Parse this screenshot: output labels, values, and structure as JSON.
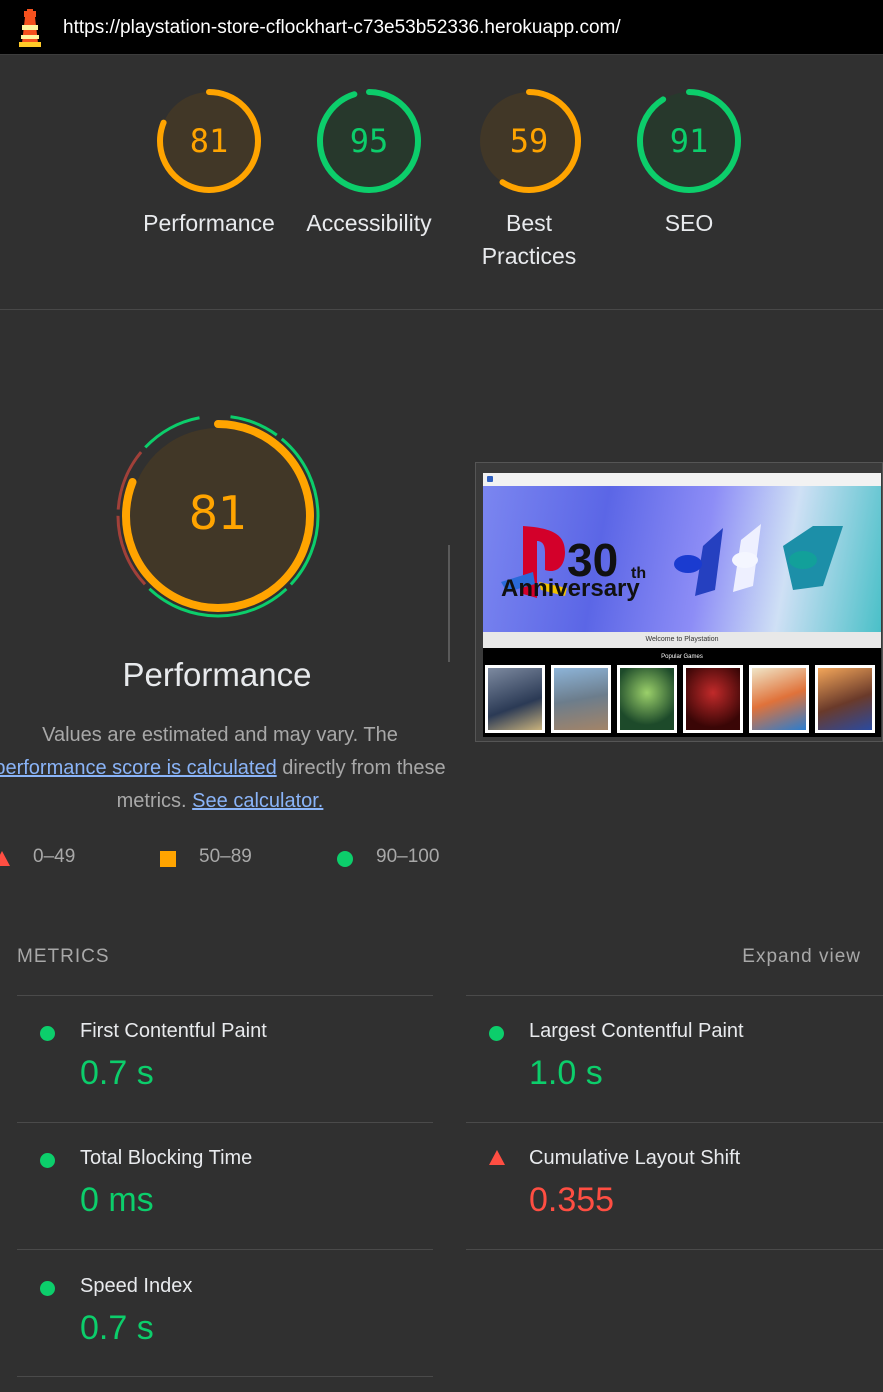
{
  "header": {
    "url": "https://playstation-store-cflockhart-c73e53b52336.herokuapp.com/"
  },
  "categories": [
    {
      "score": "81",
      "label": "Performance",
      "fraction": 0.81,
      "color": "#ffa400"
    },
    {
      "score": "95",
      "label": "Accessibility",
      "fraction": 0.95,
      "color": "#0cce6b"
    },
    {
      "score": "59",
      "label": "Best Practices",
      "fraction": 0.59,
      "color": "#ffa400"
    },
    {
      "score": "91",
      "label": "SEO",
      "fraction": 0.91,
      "color": "#0cce6b"
    }
  ],
  "performance": {
    "score": "81",
    "title": "Performance",
    "desc_pre": "Values are estimated and may vary. The ",
    "desc_link": "performance score is calculated",
    "desc_mid": " directly from these metrics. ",
    "desc_link2": "See calculator.",
    "legend": [
      {
        "range": "0–49",
        "color": "#ff4e42"
      },
      {
        "range": "50–89",
        "color": "#ffa400"
      },
      {
        "range": "90–100",
        "color": "#0cce6b"
      }
    ],
    "screenshot": {
      "hero_text_number": "30",
      "hero_text_suffix": "th",
      "hero_text_word": "Anniversary",
      "welcome": "Welcome to Playstation",
      "popular": "Popular Games"
    }
  },
  "metrics": {
    "heading": "METRICS",
    "expand_label": "Expand view",
    "items": [
      {
        "title": "First Contentful Paint",
        "value": "0.7 s",
        "status": "pass"
      },
      {
        "title": "Largest Contentful Paint",
        "value": "1.0 s",
        "status": "pass"
      },
      {
        "title": "Total Blocking Time",
        "value": "0 ms",
        "status": "pass"
      },
      {
        "title": "Cumulative Layout Shift",
        "value": "0.355",
        "status": "fail"
      },
      {
        "title": "Speed Index",
        "value": "0.7 s",
        "status": "pass"
      }
    ]
  },
  "colors": {
    "pass": "#0cce6b",
    "average": "#ffa400",
    "fail": "#ff4e42",
    "background": "#303030"
  }
}
